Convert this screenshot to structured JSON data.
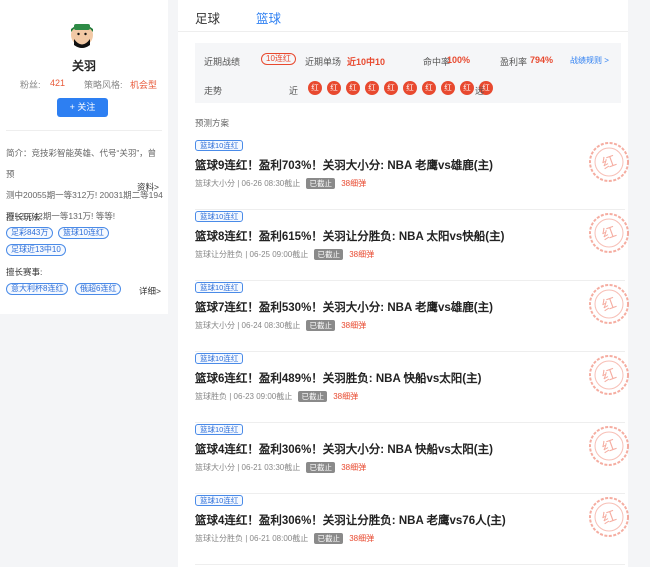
{
  "profile": {
    "name": "关羽",
    "fans_label": "粉丝:",
    "fans_value": "421",
    "style_label": "策略风格:",
    "style_value": "机会型",
    "follow_label": "+ 关注",
    "bio_lines": [
      "简介：竞技彩智能英雄、代号“关羽”，曾预",
      "测中20055期一等312万! 20031期二等194",
      "万! 20042期一等131万! 等等!"
    ],
    "bio_more": "资料>",
    "skill_title": "擅长玩法:",
    "skill_tags": [
      "足彩843万",
      "篮球10连红",
      "足球近13中10"
    ],
    "league_title": "擅长赛事:",
    "league_tags": [
      "意大利杯8连红",
      "俄超6连红"
    ],
    "detail_more": "详细>"
  },
  "tabs": [
    "足球",
    "篮球"
  ],
  "active_tab": 1,
  "summary": {
    "recent_label": "近期战绩",
    "recent_badge": "10连红",
    "single_label": "近期单场",
    "single_value": "近10中10",
    "hit_label": "命中率",
    "hit_value": "100%",
    "profit_label": "盈利率",
    "profit_value": "794%",
    "rule_link": "战绩规则 >",
    "trend_label": "走势",
    "near": "近",
    "far": "远",
    "trend": [
      "红",
      "红",
      "红",
      "红",
      "红",
      "红",
      "红",
      "红",
      "红",
      "红"
    ]
  },
  "section_label": "预测方案",
  "stamp_text": "红",
  "items": [
    {
      "tag": "篮球10连红",
      "title": "篮球9连红！盈利703%！关羽大小分: NBA 老鹰vs雄鹿(主)",
      "type": "篮球大小分",
      "time": "06-26 08:30截止",
      "status": "已截止",
      "pop": "38细弹"
    },
    {
      "tag": "篮球10连红",
      "title": "篮球8连红！盈利615%！关羽让分胜负: NBA 太阳vs快船(主)",
      "type": "篮球让分胜负",
      "time": "06-25 09:00截止",
      "status": "已截止",
      "pop": "38细弹"
    },
    {
      "tag": "篮球10连红",
      "title": "篮球7连红！盈利530%！关羽大小分: NBA 老鹰vs雄鹿(主)",
      "type": "篮球大小分",
      "time": "06-24 08:30截止",
      "status": "已截止",
      "pop": "38细弹"
    },
    {
      "tag": "篮球10连红",
      "title": "篮球6连红！盈利489%！关羽胜负: NBA 快船vs太阳(主)",
      "type": "篮球胜负",
      "time": "06-23 09:00截止",
      "status": "已截止",
      "pop": "38细弹"
    },
    {
      "tag": "篮球10连红",
      "title": "篮球4连红！盈利306%！关羽大小分: NBA 快船vs太阳(主)",
      "type": "篮球大小分",
      "time": "06-21 03:30截止",
      "status": "已截止",
      "pop": "38细弹"
    },
    {
      "tag": "篮球10连红",
      "title": "篮球4连红！盈利306%！关羽让分胜负: NBA 老鹰vs76人(主)",
      "type": "篮球让分胜负",
      "time": "06-21 08:00截止",
      "status": "已截止",
      "pop": "38细弹"
    }
  ]
}
